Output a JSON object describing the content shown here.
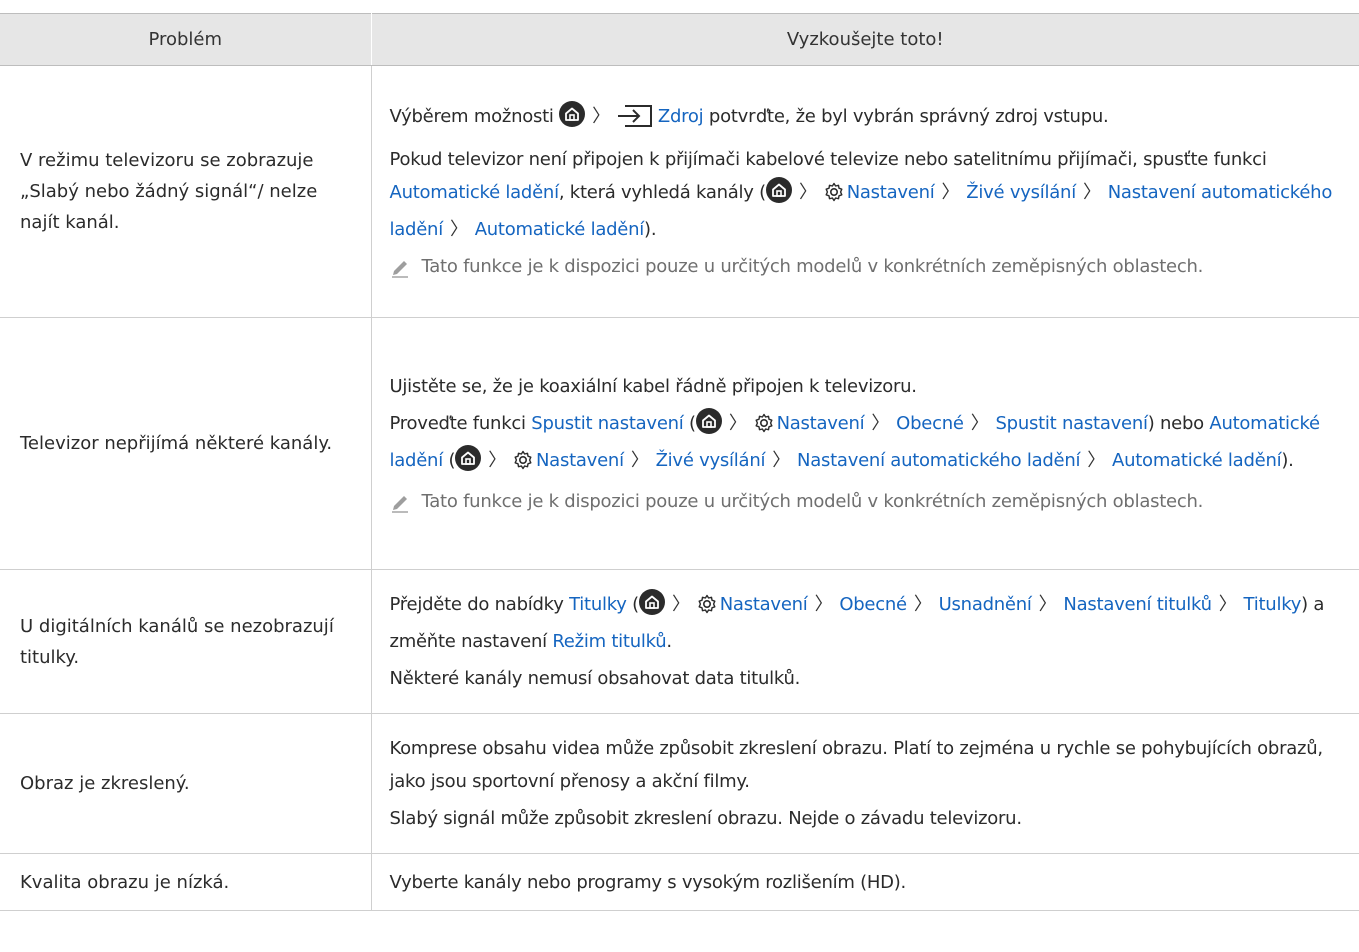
{
  "table": {
    "headers": {
      "problem": "Problém",
      "solution": "Vyzkoušejte toto!"
    },
    "rows": [
      {
        "problem": "V režimu televizoru se zobrazuje „Slabý nebo žádný signál“/ nelze najít kanál.",
        "p1": {
          "a": "Výběrem možnosti",
          "source": "Zdroj",
          "b": "potvrďte, že byl vybrán správný zdroj vstupu."
        },
        "p2": {
          "a": "Pokud televizor není připojen k přijímači kabelové televize nebo satelitnímu přijímači, spusťte funkci",
          "auto": "Automatické ladění",
          "b": ", která vyhledá kanály (",
          "settings": "Nastavení",
          "live": "Živé vysílání",
          "autoset": "Nastavení automatického ladění",
          "auto2": "Automatické ladění",
          "end": ")."
        },
        "note": "Tato funkce je k dispozici pouze u určitých modelů v konkrétních zeměpisných oblastech."
      },
      {
        "problem": "Televizor nepřijímá některé kanály.",
        "p1": "Ujistěte se, že je koaxiální kabel řádně připojen k televizoru.",
        "p2": {
          "a": "Proveďte funkci",
          "setup": "Spustit nastavení",
          "b": "(",
          "settings": "Nastavení",
          "general": "Obecné",
          "setup2": "Spustit nastavení",
          "c": ") nebo",
          "auto": "Automatické ladění",
          "d": "(",
          "settings2": "Nastavení",
          "live": "Živé vysílání",
          "autoset": "Nastavení automatického ladění",
          "auto2": "Automatické ladění",
          "end": ")."
        },
        "note": "Tato funkce je k dispozici pouze u určitých modelů v konkrétních zeměpisných oblastech."
      },
      {
        "problem": "U digitálních kanálů se nezobrazují titulky.",
        "p1": {
          "a": "Přejděte do nabídky",
          "subs": "Titulky",
          "b": "(",
          "settings": "Nastavení",
          "general": "Obecné",
          "access": "Usnadnění",
          "subset": "Nastavení titulků",
          "subs2": "Titulky",
          "c": ") a změňte nastavení",
          "submode": "Režim titulků",
          "end": "."
        },
        "p2": "Některé kanály nemusí obsahovat data titulků."
      },
      {
        "problem": "Obraz je zkreslený.",
        "p1": "Komprese obsahu videa může způsobit zkreslení obrazu. Platí to zejména u rychle se pohybujících obrazů, jako jsou sportovní přenosy a akční filmy.",
        "p2": "Slabý signál může způsobit zkreslení obrazu. Nejde o závadu televizoru."
      },
      {
        "problem": "Kvalita obrazu je nízká.",
        "p1": "Vyberte kanály nebo programy s vysokým rozlišením (HD)."
      }
    ],
    "menu_separator": "〉",
    "icons": [
      "home-icon",
      "source-icon",
      "gear-icon",
      "pencil-note-icon"
    ],
    "colors": {
      "link": "#1565c0",
      "header_bg": "#e6e6e6",
      "note_text": "#6f6f6f"
    }
  }
}
